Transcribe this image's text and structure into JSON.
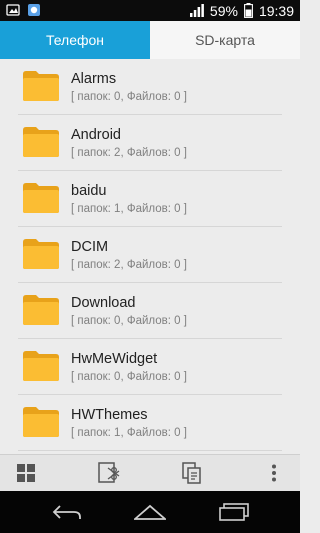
{
  "status_bar": {
    "battery": "59%",
    "time": "19:39",
    "icons": [
      "notification-icon",
      "app-notification-icon",
      "signal-icon",
      "battery-icon"
    ]
  },
  "tabs": [
    {
      "label": "Телефон",
      "active": true
    },
    {
      "label": "SD-карта",
      "active": false
    }
  ],
  "folders": [
    {
      "name": "Alarms",
      "info": "[ папок: 0, Файлов: 0 ]"
    },
    {
      "name": "Android",
      "info": "[ папок: 2, Файлов: 0 ]"
    },
    {
      "name": "baidu",
      "info": "[ папок: 1, Файлов: 0 ]"
    },
    {
      "name": "DCIM",
      "info": "[ папок: 2, Файлов: 0 ]"
    },
    {
      "name": "Download",
      "info": "[ папок: 0, Файлов: 0 ]"
    },
    {
      "name": "HwMeWidget",
      "info": "[ папок: 0, Файлов: 0 ]"
    },
    {
      "name": "HWThemes",
      "info": "[ папок: 1, Файлов: 0 ]"
    }
  ],
  "toolbar": {
    "buttons": [
      "grid-view-icon",
      "cut-icon",
      "paste-icon",
      "more-icon"
    ]
  },
  "nav_bar": {
    "buttons": [
      "back-icon",
      "home-icon",
      "recents-icon"
    ]
  },
  "colors": {
    "accent": "#19a0d8",
    "folder": "#f9b82c"
  }
}
